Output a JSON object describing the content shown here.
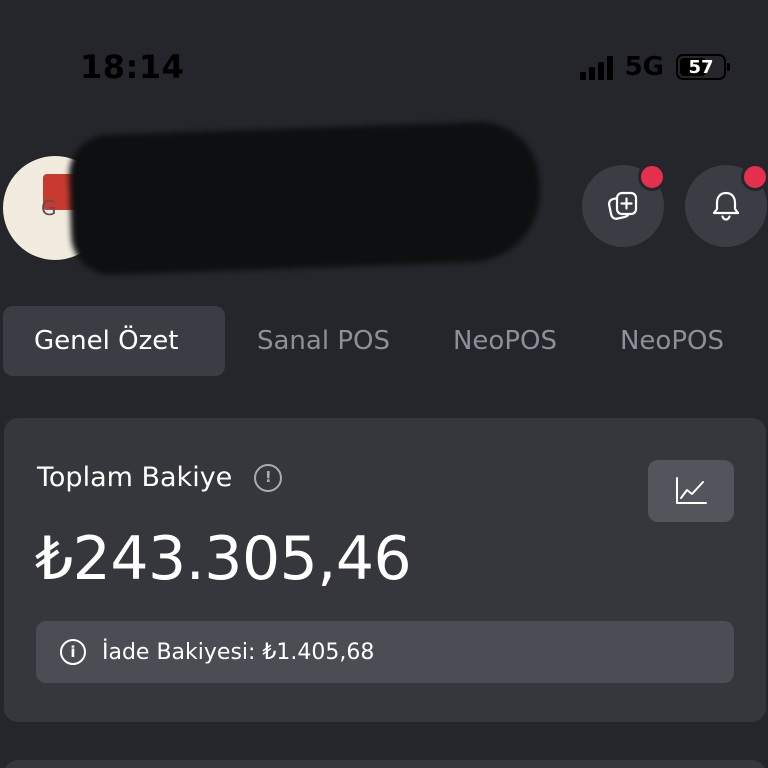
{
  "status_bar": {
    "time": "18:14",
    "network": "5G",
    "battery": "57"
  },
  "header": {
    "avatar_letter": "G",
    "add_store_icon": "copy-plus-icon",
    "notification_icon": "bell-icon",
    "badge_color": "#e5304d"
  },
  "tabs": [
    {
      "label": "Genel Özet",
      "active": true
    },
    {
      "label": "Sanal POS",
      "active": false
    },
    {
      "label": "NeoPOS",
      "active": false
    },
    {
      "label": "NeoPOS",
      "active": false
    }
  ],
  "balance_card": {
    "title": "Toplam Bakiye",
    "info_icon": "info-icon",
    "chart_icon": "line-chart-icon",
    "amount": "₺243.305,46",
    "refund_label": "İade Bakiyesi: ₺1.405,68"
  },
  "colors": {
    "background": "#24262b",
    "card": "#35373d",
    "accent_badge": "#e5304d"
  }
}
